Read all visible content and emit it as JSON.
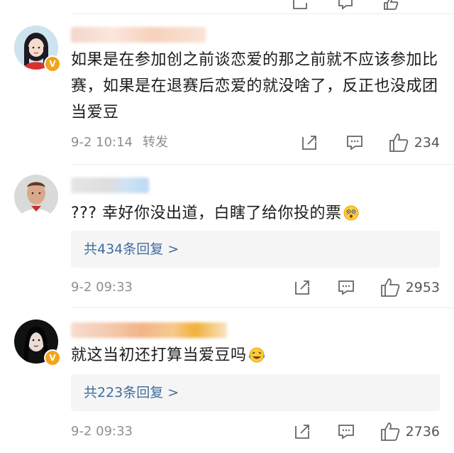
{
  "comments": [
    {
      "text": "如果是在参加创之前谈恋爱的那之前就不应该参加比赛，如果是在退赛后恋爱的就没啥了，反正也没成团当爱豆",
      "time": "9-2 10:14",
      "forward_label": "转发",
      "likes": "234",
      "verified": true
    },
    {
      "text": "??? 幸好你没出道，白瞎了给你投的票",
      "emoji": "flushed-emoji",
      "replies_label": "共434条回复 >",
      "time": "9-2 09:33",
      "likes": "2953",
      "verified": false
    },
    {
      "text": "就这当初还打算当爱豆吗",
      "emoji": "laughing-tears-emoji",
      "replies_label": "共223条回复 >",
      "time": "9-2 09:33",
      "likes": "2736",
      "verified": true
    }
  ],
  "icons": [
    "share-icon",
    "comment-icon",
    "thumbs-up-icon",
    "verified-v-icon"
  ],
  "colors": {
    "link_blue": "#3f6d9f",
    "meta_gray": "#8f8f8f",
    "reply_bg": "#f5f5f5",
    "verified_orange": "#f3a31b"
  }
}
